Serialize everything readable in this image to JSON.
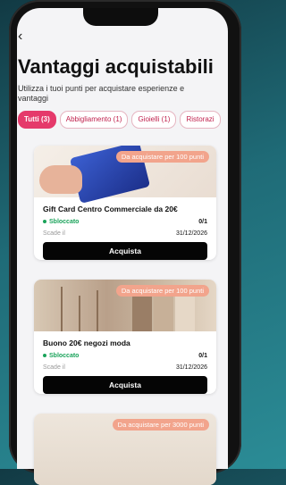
{
  "header": {
    "back_icon": "‹",
    "title": "Vantaggi acquistabili",
    "subtitle": "Utilizza i tuoi punti per acquistare esperienze e vantaggi"
  },
  "filters": [
    {
      "label": "Tutti (3)",
      "active": true
    },
    {
      "label": "Abbigliamento (1)",
      "active": false
    },
    {
      "label": "Gioielli (1)",
      "active": false
    },
    {
      "label": "Ristorazi",
      "active": false
    }
  ],
  "cards": [
    {
      "badge": "Da acquistare per 100 punti",
      "name": "Gift Card Centro Commerciale da 20€",
      "status": "Sbloccato",
      "count": "0/1",
      "expiry_label": "Scade il",
      "expiry_date": "31/12/2026",
      "button": "Acquista"
    },
    {
      "badge": "Da acquistare per 100 punti",
      "name": "Buono 20€ negozi moda",
      "status": "Sbloccato",
      "count": "0/1",
      "expiry_label": "Scade il",
      "expiry_date": "31/12/2026",
      "button": "Acquista"
    },
    {
      "badge": "Da acquistare per 3000 punti"
    }
  ],
  "colors": {
    "accent": "#e53a6b",
    "status_green": "#1aa35a",
    "badge": "#f2a48c"
  }
}
